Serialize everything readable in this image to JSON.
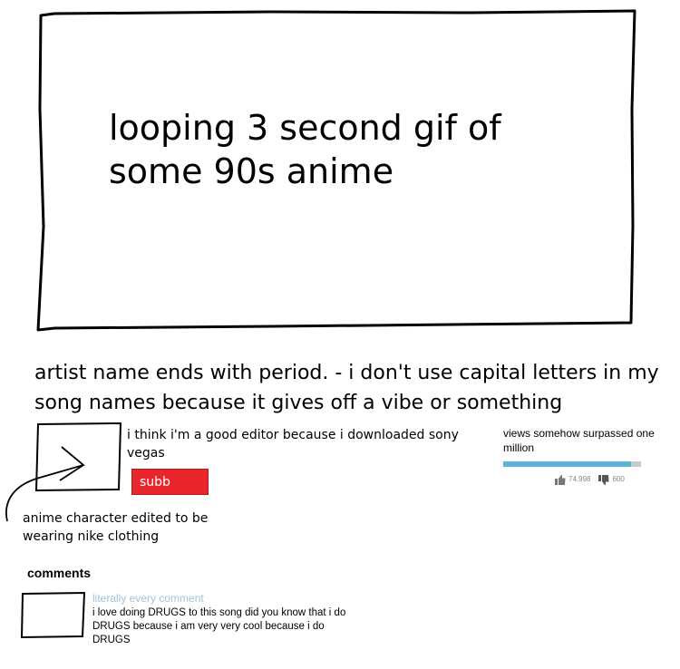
{
  "video": {
    "placeholder_text": "looping 3 second gif of some 90s anime"
  },
  "title": "artist name ends with period. - i don't use capital letters in my song names because it gives off a vibe or something",
  "channel": {
    "description": "i think i'm a good editor because i downloaded sony vegas",
    "subscribe_label": "subb",
    "avatar_caption": "anime character edited to be wearing nike clothing"
  },
  "stats": {
    "views_text": "views somehow surpassed one million",
    "like_ratio": 0.93,
    "likes": "74,998",
    "dislikes": "600"
  },
  "comments": {
    "header": "comments",
    "label": "literally every comment",
    "text": "i love doing DRUGS to this song did you know that i do DRUGS because i am very very cool because i do DRUGS"
  },
  "colors": {
    "subscribe": "#e8262b",
    "like_bar": "#5ab4d6",
    "comment_label": "#9fc4dd"
  }
}
